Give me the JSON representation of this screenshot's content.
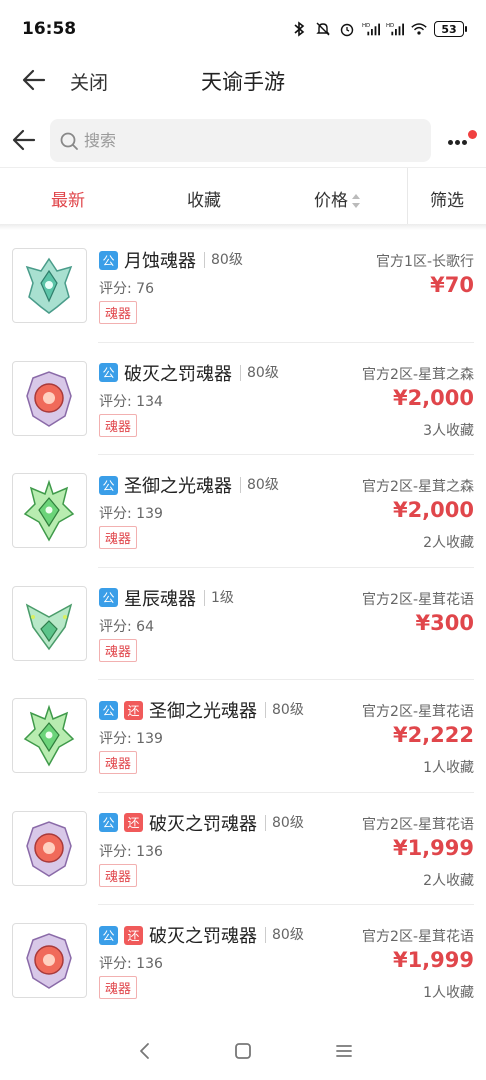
{
  "status_bar": {
    "time": "16:58",
    "battery": "53",
    "icons": [
      "bluetooth-icon",
      "mute-icon",
      "alarm-icon",
      "signal-hd-icon",
      "signal-hd-icon",
      "wifi-icon",
      "battery-icon"
    ]
  },
  "title_bar": {
    "close_label": "关闭",
    "title": "天谕手游"
  },
  "search": {
    "placeholder": "搜索"
  },
  "filters": {
    "latest": "最新",
    "favorites": "收藏",
    "price": "价格",
    "filter": "筛选",
    "active": "latest"
  },
  "colors": {
    "accent_red": "#e0464b",
    "public_badge_blue": "#3a9ee8",
    "return_badge_red": "#f05a5a"
  },
  "items": [
    {
      "badges": [
        "公"
      ],
      "name": "月蚀魂器",
      "level": "80级",
      "score": "评分: 76",
      "tag": "魂器",
      "server": "官方1区-长歌行",
      "price": "¥70",
      "favorites": "",
      "image": "green-crest"
    },
    {
      "badges": [
        "公"
      ],
      "name": "破灭之罚魂器",
      "level": "80级",
      "score": "评分: 134",
      "tag": "魂器",
      "server": "官方2区-星茸之森",
      "price": "¥2,000",
      "favorites": "3人收藏",
      "image": "red-orb"
    },
    {
      "badges": [
        "公"
      ],
      "name": "圣御之光魂器",
      "level": "80级",
      "score": "评分: 139",
      "tag": "魂器",
      "server": "官方2区-星茸之森",
      "price": "¥2,000",
      "favorites": "2人收藏",
      "image": "green-shield"
    },
    {
      "badges": [
        "公"
      ],
      "name": "星辰魂器",
      "level": "1级",
      "score": "评分: 64",
      "tag": "魂器",
      "server": "官方2区-星茸花语",
      "price": "¥300",
      "favorites": "",
      "image": "green-v"
    },
    {
      "badges": [
        "公",
        "还"
      ],
      "name": "圣御之光魂器",
      "level": "80级",
      "score": "评分: 139",
      "tag": "魂器",
      "server": "官方2区-星茸花语",
      "price": "¥2,222",
      "favorites": "1人收藏",
      "image": "green-shield"
    },
    {
      "badges": [
        "公",
        "还"
      ],
      "name": "破灭之罚魂器",
      "level": "80级",
      "score": "评分: 136",
      "tag": "魂器",
      "server": "官方2区-星茸花语",
      "price": "¥1,999",
      "favorites": "2人收藏",
      "image": "red-orb"
    },
    {
      "badges": [
        "公",
        "还"
      ],
      "name": "破灭之罚魂器",
      "level": "80级",
      "score": "评分: 136",
      "tag": "魂器",
      "server": "官方2区-星茸花语",
      "price": "¥1,999",
      "favorites": "1人收藏",
      "image": "red-orb"
    }
  ],
  "nav_bar": {
    "buttons": [
      "back-icon",
      "home-icon",
      "menu-icon"
    ]
  }
}
